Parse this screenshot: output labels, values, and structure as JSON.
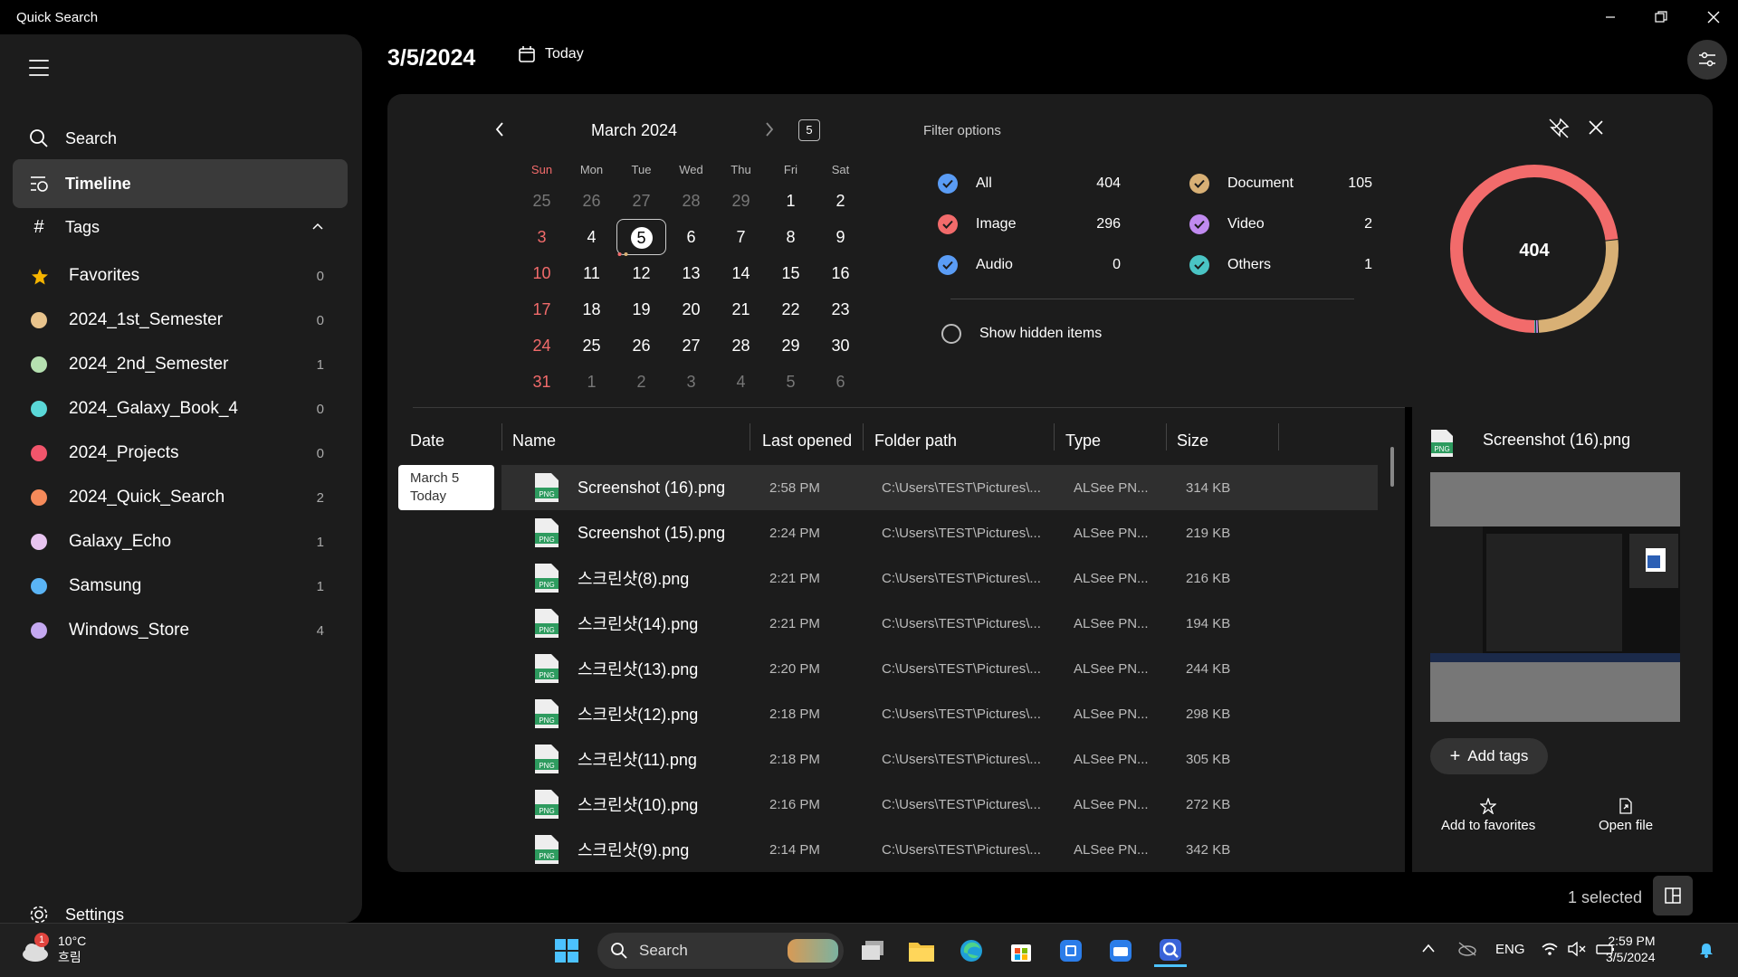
{
  "app": {
    "title": "Quick Search"
  },
  "sidebar": {
    "search": "Search",
    "timeline": "Timeline",
    "tags": "Tags",
    "settings": "Settings",
    "tag_items": [
      {
        "label": "Favorites",
        "count": "0",
        "color": "#f5b400"
      },
      {
        "label": "2024_1st_Semester",
        "count": "0",
        "color": "#e8c38c"
      },
      {
        "label": "2024_2nd_Semester",
        "count": "1",
        "color": "#b5e0b0"
      },
      {
        "label": "2024_Galaxy_Book_4",
        "count": "0",
        "color": "#5ad8d8"
      },
      {
        "label": "2024_Projects",
        "count": "0",
        "color": "#f2556b"
      },
      {
        "label": "2024_Quick_Search",
        "count": "2",
        "color": "#f58a5a"
      },
      {
        "label": "Galaxy_Echo",
        "count": "1",
        "color": "#e8c4f0"
      },
      {
        "label": "Samsung",
        "count": "1",
        "color": "#5ab4f5"
      },
      {
        "label": "Windows_Store",
        "count": "4",
        "color": "#c4a8f0"
      }
    ]
  },
  "header": {
    "date": "3/5/2024",
    "today": "Today"
  },
  "calendar": {
    "month": "March 2024",
    "today_badge": "5",
    "dow": [
      "Sun",
      "Mon",
      "Tue",
      "Wed",
      "Thu",
      "Fri",
      "Sat"
    ],
    "weeks": [
      [
        "25",
        "26",
        "27",
        "28",
        "29",
        "1",
        "2"
      ],
      [
        "3",
        "4",
        "5",
        "6",
        "7",
        "8",
        "9"
      ],
      [
        "10",
        "11",
        "12",
        "13",
        "14",
        "15",
        "16"
      ],
      [
        "17",
        "18",
        "19",
        "20",
        "21",
        "22",
        "23"
      ],
      [
        "24",
        "25",
        "26",
        "27",
        "28",
        "29",
        "30"
      ],
      [
        "31",
        "1",
        "2",
        "3",
        "4",
        "5",
        "6"
      ]
    ]
  },
  "filter": {
    "title": "Filter options",
    "items": [
      {
        "label": "All",
        "count": "404",
        "color": "#5a9cf5"
      },
      {
        "label": "Image",
        "count": "296",
        "color": "#f26b6b"
      },
      {
        "label": "Audio",
        "count": "0",
        "color": "#5a9cf5"
      },
      {
        "label": "Document",
        "count": "105",
        "color": "#d8b075"
      },
      {
        "label": "Video",
        "count": "2",
        "color": "#c08af0"
      },
      {
        "label": "Others",
        "count": "1",
        "color": "#4ac4c4"
      }
    ],
    "show_hidden": "Show hidden items",
    "total": "404"
  },
  "chart_data": {
    "type": "pie",
    "categories": [
      "Image",
      "Document",
      "Video",
      "Others",
      "Audio"
    ],
    "values": [
      296,
      105,
      2,
      1,
      0
    ],
    "colors": [
      "#f26b6b",
      "#d8b075",
      "#c08af0",
      "#4ac4c4",
      "#5a9cf5"
    ]
  },
  "table": {
    "headers": [
      "Date",
      "Name",
      "Last opened",
      "Folder path",
      "Type",
      "Size"
    ],
    "date_group": {
      "line1": "March 5",
      "line2": "Today"
    },
    "rows": [
      {
        "name": "Screenshot (16).png",
        "time": "2:58 PM",
        "path": "C:\\Users\\TEST\\Pictures\\...",
        "type": "ALSee PN...",
        "size": "314 KB"
      },
      {
        "name": "Screenshot (15).png",
        "time": "2:24 PM",
        "path": "C:\\Users\\TEST\\Pictures\\...",
        "type": "ALSee PN...",
        "size": "219 KB"
      },
      {
        "name": "스크린샷(8).png",
        "time": "2:21 PM",
        "path": "C:\\Users\\TEST\\Pictures\\...",
        "type": "ALSee PN...",
        "size": "216 KB"
      },
      {
        "name": "스크린샷(14).png",
        "time": "2:21 PM",
        "path": "C:\\Users\\TEST\\Pictures\\...",
        "type": "ALSee PN...",
        "size": "194 KB"
      },
      {
        "name": "스크린샷(13).png",
        "time": "2:20 PM",
        "path": "C:\\Users\\TEST\\Pictures\\...",
        "type": "ALSee PN...",
        "size": "244 KB"
      },
      {
        "name": "스크린샷(12).png",
        "time": "2:18 PM",
        "path": "C:\\Users\\TEST\\Pictures\\...",
        "type": "ALSee PN...",
        "size": "298 KB"
      },
      {
        "name": "스크린샷(11).png",
        "time": "2:18 PM",
        "path": "C:\\Users\\TEST\\Pictures\\...",
        "type": "ALSee PN...",
        "size": "305 KB"
      },
      {
        "name": "스크린샷(10).png",
        "time": "2:16 PM",
        "path": "C:\\Users\\TEST\\Pictures\\...",
        "type": "ALSee PN...",
        "size": "272 KB"
      },
      {
        "name": "스크린샷(9).png",
        "time": "2:14 PM",
        "path": "C:\\Users\\TEST\\Pictures\\...",
        "type": "ALSee PN...",
        "size": "342 KB"
      }
    ],
    "file_badge": "PNG"
  },
  "details": {
    "name": "Screenshot (16).png",
    "add_tags": "Add tags",
    "add_favorites": "Add to favorites",
    "open_file": "Open file"
  },
  "status": {
    "selected": "1 selected"
  },
  "taskbar": {
    "temp": "10°C",
    "condition": "흐림",
    "alert": "1",
    "search": "Search",
    "lang": "ENG",
    "time": "2:59 PM",
    "date": "3/5/2024"
  }
}
